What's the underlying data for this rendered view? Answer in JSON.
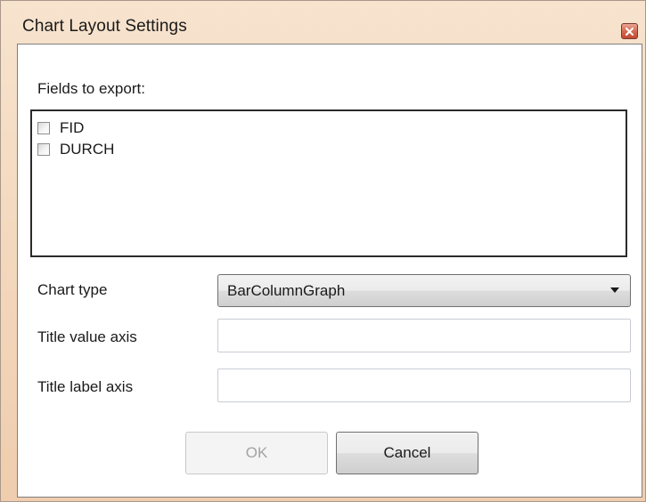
{
  "window": {
    "title": "Chart Layout Settings"
  },
  "icons": {
    "close": "close-icon",
    "dropdown": "chevron-down-icon"
  },
  "fields": {
    "label": "Fields to export:",
    "items": [
      {
        "label": "FID",
        "checked": false
      },
      {
        "label": "DURCH",
        "checked": false
      }
    ]
  },
  "chart_type": {
    "label": "Chart type",
    "value": "BarColumnGraph"
  },
  "title_value_axis": {
    "label": "Title value axis",
    "value": ""
  },
  "title_label_axis": {
    "label": "Title label axis",
    "value": ""
  },
  "buttons": {
    "ok": "OK",
    "cancel": "Cancel",
    "ok_enabled": false
  },
  "colors": {
    "titlebar": "#f3d6ba",
    "close_button": "#d46a52",
    "disabled_text": "#a3a3a3"
  }
}
